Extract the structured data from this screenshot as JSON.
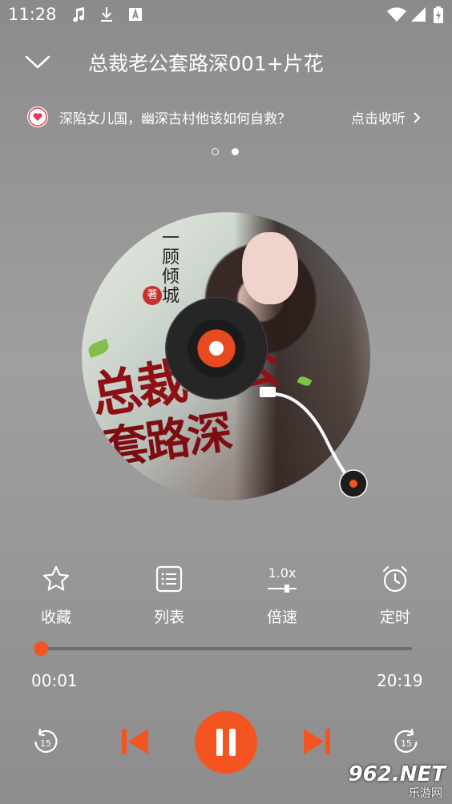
{
  "status_bar": {
    "time": "11:28",
    "icons": [
      "music-note-icon",
      "download-icon",
      "font-a-icon",
      "wifi-icon",
      "signal-icon",
      "battery-icon"
    ]
  },
  "header": {
    "title": "总裁老公套路深001+片花"
  },
  "banner": {
    "text": "深陷女儿国，幽深古村他该如何自救？",
    "action": "点击收听"
  },
  "carousel": {
    "pages": 2,
    "active_index": 1
  },
  "cover": {
    "author": "一顾倾城",
    "author_mark": "著",
    "title_line1": "总裁老公",
    "title_line2": "套路深"
  },
  "controls": {
    "favorite_label": "收藏",
    "list_label": "列表",
    "speed_value": "1.0x",
    "speed_label": "倍速",
    "timer_label": "定时"
  },
  "player": {
    "current_time": "00:01",
    "total_time": "20:19",
    "progress_fraction": 0.001,
    "rewind_seconds": "15",
    "forward_seconds": "15",
    "state": "playing"
  },
  "colors": {
    "accent": "#f4541f",
    "heart": "#e33b5a"
  },
  "watermark": {
    "brand": "962.NET",
    "sub": "乐游网"
  }
}
